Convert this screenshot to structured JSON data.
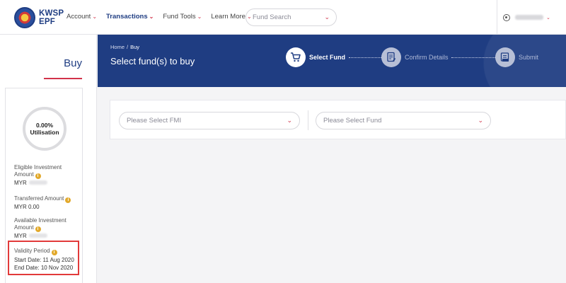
{
  "brand": {
    "line1": "KWSP",
    "line2": "EPF"
  },
  "nav": {
    "items": [
      {
        "label": "Account"
      },
      {
        "label": "Transactions"
      },
      {
        "label": "Fund Tools"
      },
      {
        "label": "Learn More"
      }
    ],
    "search_placeholder": "Fund Search"
  },
  "sidebar": {
    "title": "Buy",
    "utilisation": {
      "value": "0.00%",
      "label": "Utilisation"
    },
    "eligible": {
      "label": "Eligible Investment Amount",
      "currency": "MYR"
    },
    "transferred": {
      "label": "Transferred Amount",
      "value": "MYR 0.00"
    },
    "available": {
      "label": "Available Investment Amount",
      "currency": "MYR"
    },
    "validity": {
      "label": "Validity Period",
      "start_label": "Start Date:",
      "start_value": "11 Aug 2020",
      "end_label": "End Date:",
      "end_value": "10 Nov 2020"
    }
  },
  "banner": {
    "breadcrumb_home": "Home",
    "breadcrumb_sep": "/",
    "breadcrumb_current": "Buy",
    "title": "Select fund(s) to buy",
    "steps": [
      {
        "label": "Select Fund",
        "state": "active"
      },
      {
        "label": "Confirm Details",
        "state": "inactive"
      },
      {
        "label": "Submit",
        "state": "inactive"
      }
    ]
  },
  "filters": {
    "fmi_placeholder": "Please Select FMI",
    "fund_placeholder": "Please Select Fund"
  },
  "colors": {
    "primary": "#1f3d82",
    "accent": "#d2334a",
    "highlight": "#e23a3a",
    "info": "#e2a92b"
  },
  "icons": [
    "user-icon",
    "chevron-down-icon",
    "cart-icon",
    "document-icon",
    "submit-icon",
    "info-icon"
  ]
}
